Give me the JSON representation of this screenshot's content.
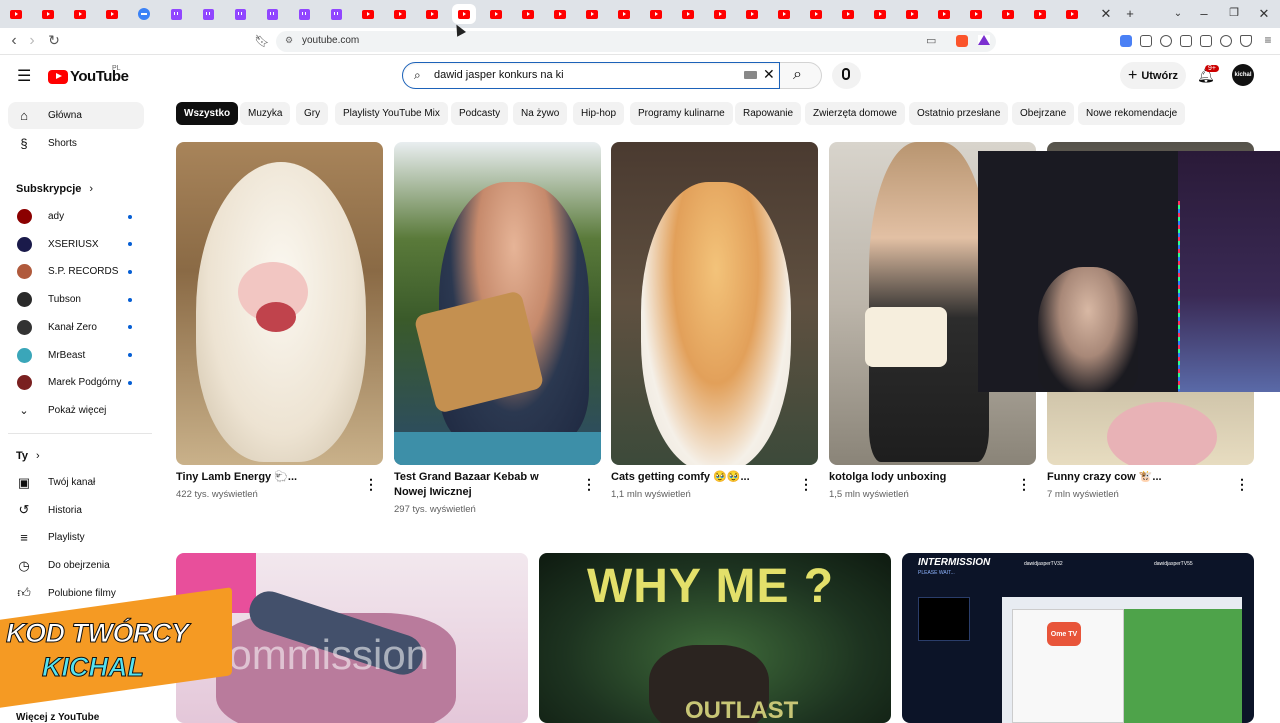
{
  "browser": {
    "url": "youtube.com",
    "tabs": [
      {
        "icon": "youtube-favicon-icon"
      },
      {
        "icon": "youtube-favicon-icon"
      },
      {
        "icon": "youtube-favicon-icon"
      },
      {
        "icon": "youtube-favicon-icon"
      },
      {
        "icon": "chat-favicon-icon"
      },
      {
        "icon": "twitch-favicon-icon"
      },
      {
        "icon": "twitch-favicon-icon"
      },
      {
        "icon": "twitch-favicon-icon"
      },
      {
        "icon": "twitch-favicon-icon"
      },
      {
        "icon": "twitch-favicon-icon"
      },
      {
        "icon": "twitch-favicon-icon"
      },
      {
        "icon": "youtube-favicon-icon"
      },
      {
        "icon": "youtube-favicon-icon"
      },
      {
        "icon": "youtube-favicon-icon"
      },
      {
        "icon": "youtube-favicon-icon",
        "active": true
      },
      {
        "icon": "youtube-favicon-icon"
      },
      {
        "icon": "youtube-favicon-icon"
      },
      {
        "icon": "youtube-favicon-icon"
      },
      {
        "icon": "youtube-favicon-icon"
      },
      {
        "icon": "youtube-favicon-icon"
      },
      {
        "icon": "youtube-favicon-icon"
      },
      {
        "icon": "youtube-favicon-icon"
      },
      {
        "icon": "youtube-favicon-icon"
      },
      {
        "icon": "youtube-favicon-icon"
      },
      {
        "icon": "youtube-favicon-icon"
      },
      {
        "icon": "youtube-favicon-icon"
      },
      {
        "icon": "youtube-favicon-icon"
      },
      {
        "icon": "youtube-favicon-icon"
      },
      {
        "icon": "youtube-favicon-icon"
      },
      {
        "icon": "youtube-favicon-icon"
      },
      {
        "icon": "youtube-favicon-icon"
      },
      {
        "icon": "youtube-favicon-icon"
      },
      {
        "icon": "youtube-favicon-icon"
      },
      {
        "icon": "youtube-favicon-icon"
      }
    ],
    "close_tab_glyph": "✕",
    "new_tab_glyph": "+"
  },
  "header": {
    "logo_text": "YouTube",
    "logo_country": "PL",
    "search_value": "dawid jasper konkurs na ki",
    "create_label": "Utwórz",
    "notification_count": "9+",
    "avatar_text": "kichal"
  },
  "sidebar": {
    "main": [
      {
        "label": "Główna",
        "icon": "home-icon",
        "active": true
      },
      {
        "label": "Shorts",
        "icon": "shorts-icon"
      }
    ],
    "subscriptions_heading": "Subskrypcje",
    "channels": [
      {
        "label": "ady",
        "color": "#8b0000"
      },
      {
        "label": "XSERIUSX",
        "color": "#1a1a4a"
      },
      {
        "label": "S.P. RECORDS",
        "color": "#b05a3c"
      },
      {
        "label": "Tubson",
        "color": "#2a2a2a"
      },
      {
        "label": "Kanał Zero",
        "color": "#333333"
      },
      {
        "label": "MrBeast",
        "color": "#3aa6b9"
      },
      {
        "label": "Marek Podgórny",
        "color": "#7a2020"
      }
    ],
    "show_more_label": "Pokaż więcej",
    "you_heading": "Ty",
    "you_items": [
      {
        "label": "Twój kanał",
        "icon": "channel-icon"
      },
      {
        "label": "Historia",
        "icon": "history-icon"
      },
      {
        "label": "Playlisty",
        "icon": "playlists-icon"
      },
      {
        "label": "Do obejrzenia",
        "icon": "watch-later-icon"
      },
      {
        "label": "Polubione filmy",
        "icon": "liked-icon"
      }
    ],
    "more_heading": "Więcej z YouTube"
  },
  "chips": [
    "Wszystko",
    "Muzyka",
    "Gry",
    "Playlisty YouTube Mix",
    "Podcasty",
    "Na żywo",
    "Hip-hop",
    "Programy kulinarne",
    "Rapowanie",
    "Zwierzęta domowe",
    "Ostatnio przesłane",
    "Obejrzane",
    "Nowe rekomendacje"
  ],
  "videos_row1": [
    {
      "title": "Tiny Lamb Energy 🐑...",
      "views": "422 tys. wyświetleń"
    },
    {
      "title": "Test Grand Bazaar Kebab w Nowej Iwicznej",
      "views": "297 tys. wyświetleń"
    },
    {
      "title": "Cats getting comfy 🥹🥹...",
      "views": "1,1 mln wyświetleń"
    },
    {
      "title": "kotolga lody unboxing",
      "views": "1,5 mln wyświetleń"
    },
    {
      "title": "Funny crazy cow 🐮...",
      "views": "7 mln wyświetleń"
    }
  ],
  "videos_row2": [
    {
      "thumb_text": "Commission"
    },
    {
      "thumb_text": "WHY ME ?",
      "thumb_sub": "OUTLAST"
    },
    {
      "thumb_text": "INTERMISSION",
      "thumb_sub": "PLEASE WAIT...",
      "stream_names": [
        "dawidjasperTV32",
        "dawidjasperTV55"
      ],
      "app_label": "Ome TV"
    }
  ],
  "overlay": {
    "code_line1": "KOD TWÓRCY",
    "code_line2": "KICHAL"
  },
  "colors": {
    "accent": "#ff0000",
    "link_blue": "#065fd4",
    "chip_bg": "#f2f2f2"
  }
}
